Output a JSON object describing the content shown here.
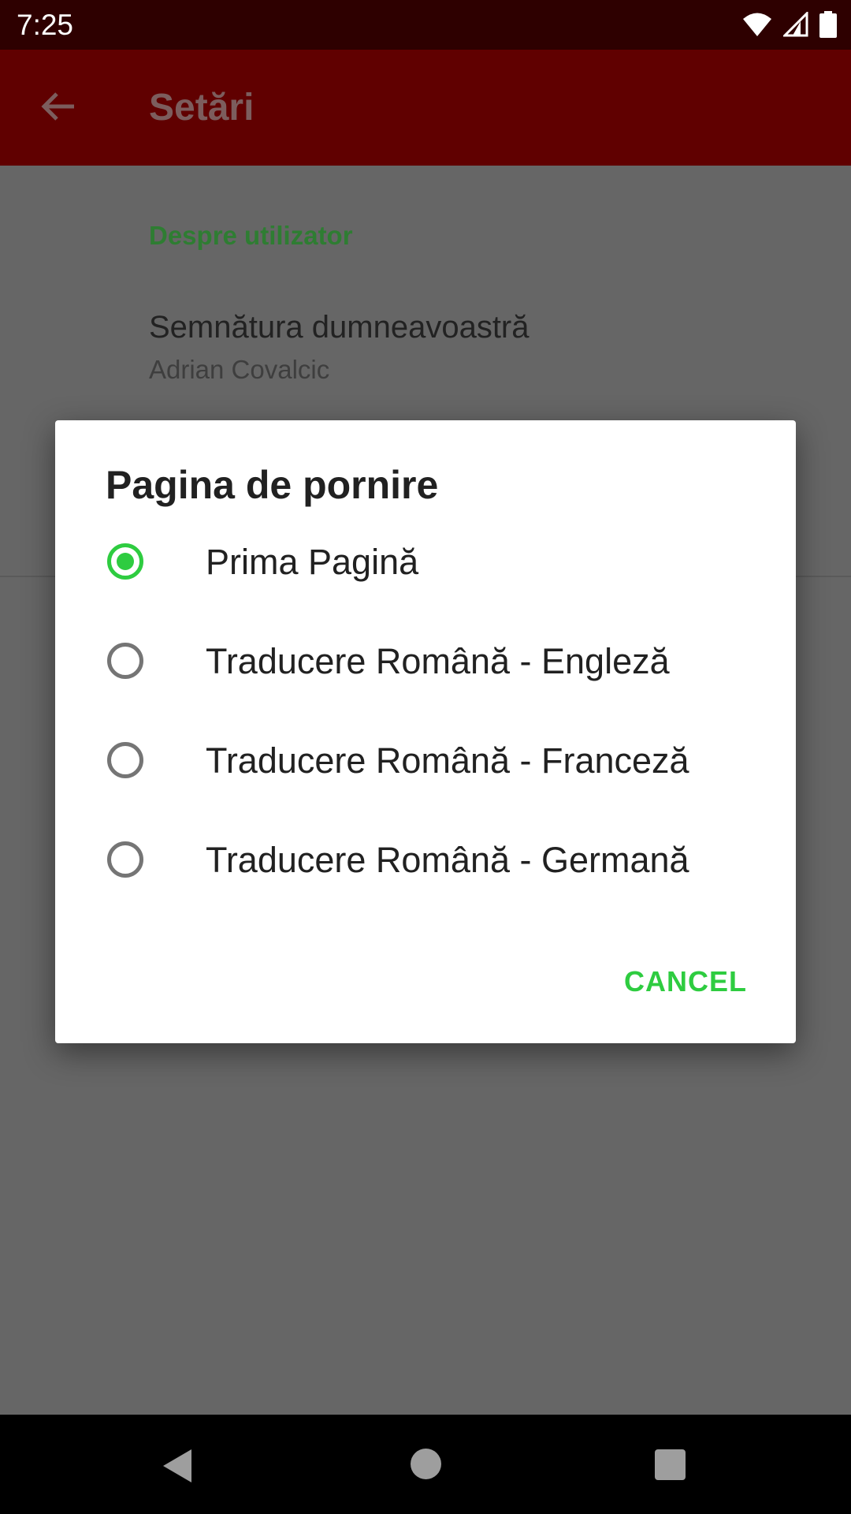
{
  "status_bar": {
    "time": "7:25",
    "icons": [
      "wifi-icon",
      "cell-signal-icon",
      "battery-icon"
    ]
  },
  "app_bar": {
    "title": "Setări",
    "back_icon": "arrow-back-icon"
  },
  "settings": {
    "section_header": "Despre utilizator",
    "signature_title": "Semnătura dumneavoastră",
    "signature_value": "Adrian Covalcic"
  },
  "dialog": {
    "title": "Pagina de pornire",
    "options": [
      {
        "label": "Prima Pagină",
        "checked": true
      },
      {
        "label": "Traducere Română - Engleză",
        "checked": false
      },
      {
        "label": "Traducere Română - Franceză",
        "checked": false
      },
      {
        "label": "Traducere Română - Germană",
        "checked": false
      }
    ],
    "cancel_label": "CANCEL"
  },
  "colors": {
    "accent": "#2ecc40",
    "app_bar": "#600000",
    "status_bar": "#2e0000"
  },
  "nav_bar": {
    "icons": [
      "nav-back-icon",
      "nav-home-icon",
      "nav-recents-icon"
    ]
  }
}
